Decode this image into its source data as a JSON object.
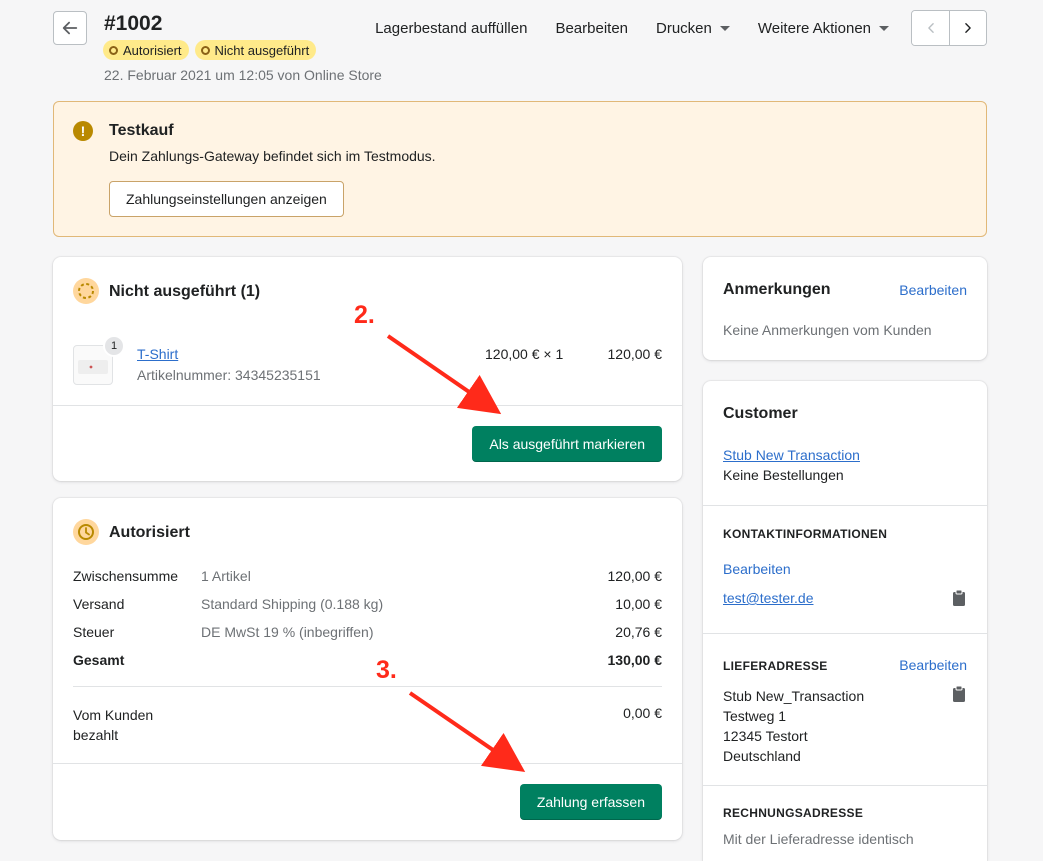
{
  "header": {
    "order_number": "#1002",
    "badges": [
      "Autorisiert",
      "Nicht ausgeführt"
    ],
    "meta": "22. Februar 2021 um 12:05 von Online Store",
    "actions": {
      "restock": "Lagerbestand auffüllen",
      "edit": "Bearbeiten",
      "print": "Drucken",
      "more": "Weitere Aktionen"
    }
  },
  "banner": {
    "title": "Testkauf",
    "text": "Dein Zahlungs-Gateway befindet sich im Testmodus.",
    "button": "Zahlungseinstellungen anzeigen",
    "icon_glyph": "!"
  },
  "unfulfilled": {
    "title": "Nicht ausgeführt (1)",
    "item": {
      "name": "T-Shirt",
      "sku": "Artikelnummer: 34345235151",
      "qty_badge": "1",
      "unit_price": "120,00 € × 1",
      "total": "120,00 €"
    },
    "button": "Als ausgeführt markieren"
  },
  "authorized": {
    "title": "Autorisiert",
    "rows": [
      {
        "label": "Zwischensumme",
        "detail": "1 Artikel",
        "amount": "120,00 €"
      },
      {
        "label": "Versand",
        "detail": "Standard Shipping (0.188 kg)",
        "amount": "10,00 €"
      },
      {
        "label": "Steuer",
        "detail": "DE MwSt 19 % (inbegriffen)",
        "amount": "20,76 €"
      },
      {
        "label": "Gesamt",
        "detail": "",
        "amount": "130,00 €"
      }
    ],
    "paid_label_line1": "Vom Kunden",
    "paid_label_line2": "bezahlt",
    "paid_amount": "0,00 €",
    "button": "Zahlung erfassen"
  },
  "notes": {
    "title": "Anmerkungen",
    "edit": "Bearbeiten",
    "text": "Keine Anmerkungen vom Kunden"
  },
  "customer": {
    "title": "Customer",
    "name": "Stub New Transaction",
    "orders": "Keine Bestellungen",
    "contact_title": "KONTAKTINFORMATIONEN",
    "contact_edit": "Bearbeiten",
    "email": "test@tester.de",
    "shipping_title": "LIEFERADRESSE",
    "shipping_edit": "Bearbeiten",
    "shipping_lines": [
      "Stub New_Transaction",
      "Testweg 1",
      "12345 Testort",
      "Deutschland"
    ],
    "billing_title": "RECHNUNGSADRESSE",
    "billing_text": "Mit der Lieferadresse identisch"
  },
  "annotations": {
    "step2": "2.",
    "step3": "3.",
    "color": "#ff2a1a"
  },
  "colors": {
    "primary": "#008060",
    "link": "#2c6ecb",
    "badge": "#ffea8a",
    "banner_bg": "#fff4e4"
  }
}
